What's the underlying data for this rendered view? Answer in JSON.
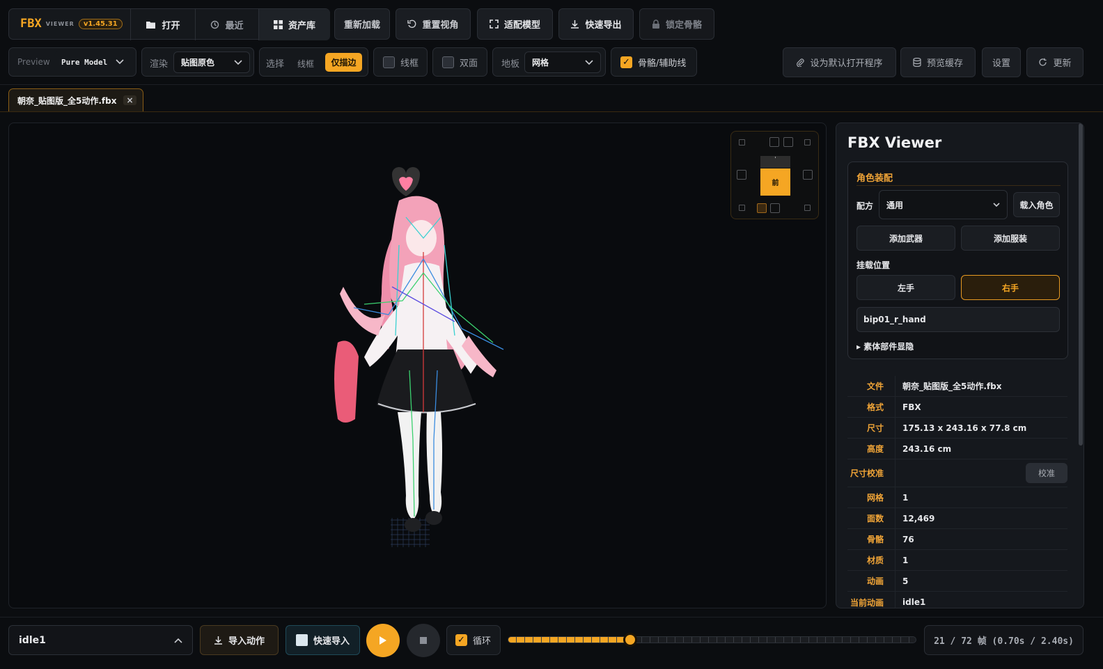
{
  "app": {
    "logo_main": "FBX",
    "logo_sub": "VIEWER",
    "version": "v1.45.31"
  },
  "toolbar": {
    "open": "打开",
    "recent": "最近",
    "library": "资产库",
    "reload": "重新加载",
    "reset_view": "重置视角",
    "fit_model": "适配模型",
    "quick_export": "快速导出",
    "lock_bones": "锁定骨骼"
  },
  "toolbar2": {
    "preview_label": "Preview",
    "preview_value": "Pure Model",
    "render_label": "渲染",
    "render_value": "贴图原色",
    "select_label": "选择",
    "select_wireframe": "线框",
    "select_outline": "仅描边",
    "wireframe": "线框",
    "double_sided": "双面",
    "floor_label": "地板",
    "floor_value": "网格",
    "bones_helpers": "骨骼/辅助线",
    "set_default": "设为默认打开程序",
    "preview_cache": "预览缓存",
    "settings": "设置",
    "update": "更新"
  },
  "tab": {
    "filename": "朝奈_贴图版_全5动作.fbx",
    "close": "×"
  },
  "gizmo": {
    "front": "前"
  },
  "panel": {
    "title": "FBX Viewer",
    "rig_section": "角色装配",
    "preset_label": "配方",
    "preset_value": "通用",
    "load_character": "载入角色",
    "add_weapon": "添加武器",
    "add_outfit": "添加服装",
    "mount_label": "挂载位置",
    "left_hand": "左手",
    "right_hand": "右手",
    "bone_name": "bip01_r_hand",
    "parts_toggle": "▸ 素体部件显隐",
    "info": [
      {
        "key": "文件",
        "value": "朝奈_贴图版_全5动作.fbx"
      },
      {
        "key": "格式",
        "value": "FBX"
      },
      {
        "key": "尺寸",
        "value": "175.13 x 243.16 x 77.8 cm"
      },
      {
        "key": "高度",
        "value": "243.16 cm"
      },
      {
        "key": "尺寸校准",
        "value": ""
      },
      {
        "key": "网格",
        "value": "1"
      },
      {
        "key": "面数",
        "value": "12,469"
      },
      {
        "key": "骨骼",
        "value": "76"
      },
      {
        "key": "材质",
        "value": "1"
      },
      {
        "key": "动画",
        "value": "5"
      },
      {
        "key": "当前动画",
        "value": "idle1"
      }
    ],
    "calibrate": "校准"
  },
  "bottom": {
    "animation": "idle1",
    "import_anim": "导入动作",
    "quick_import": "快速导入",
    "loop": "循环",
    "progress": 0.3,
    "frame_text": "21 / 72 帧 (0.70s / 2.40s)"
  },
  "colors": {
    "accent": "#f5a623",
    "bg": "#0b0d10"
  }
}
